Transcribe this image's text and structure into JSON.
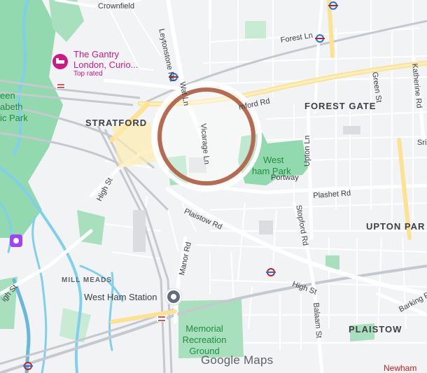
{
  "map": {
    "watermark": "Google Maps",
    "colors": {
      "land": "#f1f3f4",
      "park": "#93d9b0",
      "water": "#7fd0ec",
      "road": "#ffffff",
      "major_road": "#fde293",
      "rail": "#c4c9cf",
      "ring": "#b56a52",
      "poi": "#d01884"
    },
    "areas": {
      "stratford": "STRATFORD",
      "forest_gate": "FOREST GATE",
      "upton_park": "UPTON PAR",
      "plaistow": "PLAISTOW",
      "mill_meads": "MILL MEADS",
      "crownfield": "Crownfield",
      "newham": "Newham"
    },
    "parks": {
      "qe_line1": "een",
      "qe_line2": "abeth",
      "qe_line3": "ic Park",
      "west_ham_line1": "West",
      "west_ham_line2": "ham Park",
      "memorial_line1": "Memorial",
      "memorial_line2": "Recreation",
      "memorial_line3": "Ground"
    },
    "roads": {
      "forest_ln": "Forest Ln",
      "leytonstone_rd": "Leytonstone Rd",
      "romford_rd": "mford Rd",
      "water_ln": "Wat Ln",
      "vicarage_ln": "Vicarage Ln",
      "high_st_west": "High St",
      "high_st_east": "High St",
      "portway": "Portway",
      "plashet_rd": "Plashet Rd",
      "plaistow_rd": "Plaistow Rd",
      "upton_ln": "Upton Ln",
      "stopford_rd": "Stopford Rd",
      "manor_rd": "Manor Rd",
      "green_st": "Green St",
      "katherine_rd": "Katherine Rd",
      "barking_rd": "Barking Rd",
      "balaam_st": "Balaam St",
      "high_st_sw": "igh St",
      "sri_fragment": "Sri"
    },
    "pois": {
      "gantry_line1": "The Gantry",
      "gantry_line2": "London, Curio...",
      "gantry_badge": "Top rated",
      "west_ham_station": "West Ham Station"
    },
    "icons": [
      "hotel-icon",
      "train-station-icon",
      "underground-icon",
      "rail-icon",
      "attraction-icon"
    ],
    "marker": {
      "shape": "ring",
      "color": "#b56a52"
    }
  }
}
